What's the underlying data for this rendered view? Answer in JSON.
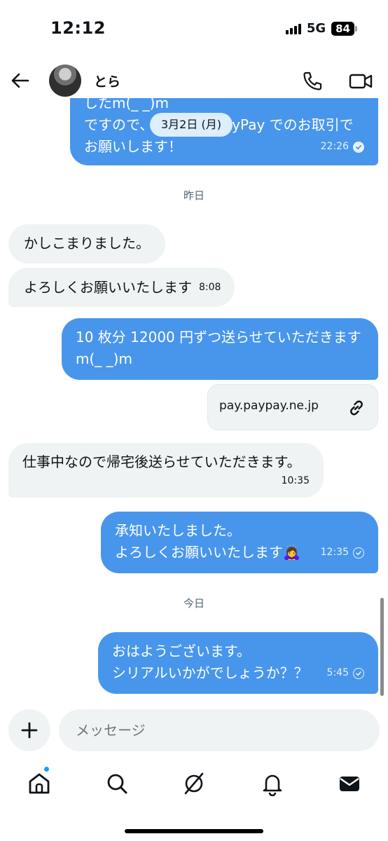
{
  "status_bar": {
    "time": "12:12",
    "network": "5G",
    "battery": "84"
  },
  "header": {
    "contact_name": "とら"
  },
  "chat": {
    "top_partial": {
      "line1": "したm(_ _)m",
      "line2_prefix": "ですので、",
      "line2_suffix": "yPay でのお取引で",
      "line3": "お願いします！",
      "time": "22:26"
    },
    "date_pill": "3月2日 (月)",
    "separator_yesterday": "昨日",
    "separator_today": "今日",
    "messages": [
      {
        "text": "かしこまりました。"
      },
      {
        "text": "よろしくお願いいたします",
        "time": "8:08"
      },
      {
        "line1": "10 枚分 12000 円ずつ送らせていただきます",
        "line2": "m(_ _)m"
      },
      {
        "text": "仕事中なので帰宅後送らせていただきます。",
        "time": "10:35"
      },
      {
        "line1": "承知いたしました。",
        "line2": "よろしくお願いいたします",
        "emoji": "🙇‍♀️",
        "time": "12:35"
      },
      {
        "line1": "おはようございます。",
        "line2": "シリアルいかがでしょうか？？",
        "time": "5:45"
      }
    ],
    "link_card": {
      "url": "pay.paypay.ne.jp",
      "icon": "link-icon"
    }
  },
  "composer": {
    "placeholder": "メッセージ"
  },
  "tabs": [
    "home-icon",
    "search-icon",
    "grok-icon",
    "notifications-icon",
    "messages-icon"
  ],
  "colors": {
    "outgoing_bubble": "#4896ec",
    "incoming_bubble": "#eff3f4",
    "accent": "#1d9bf0"
  }
}
